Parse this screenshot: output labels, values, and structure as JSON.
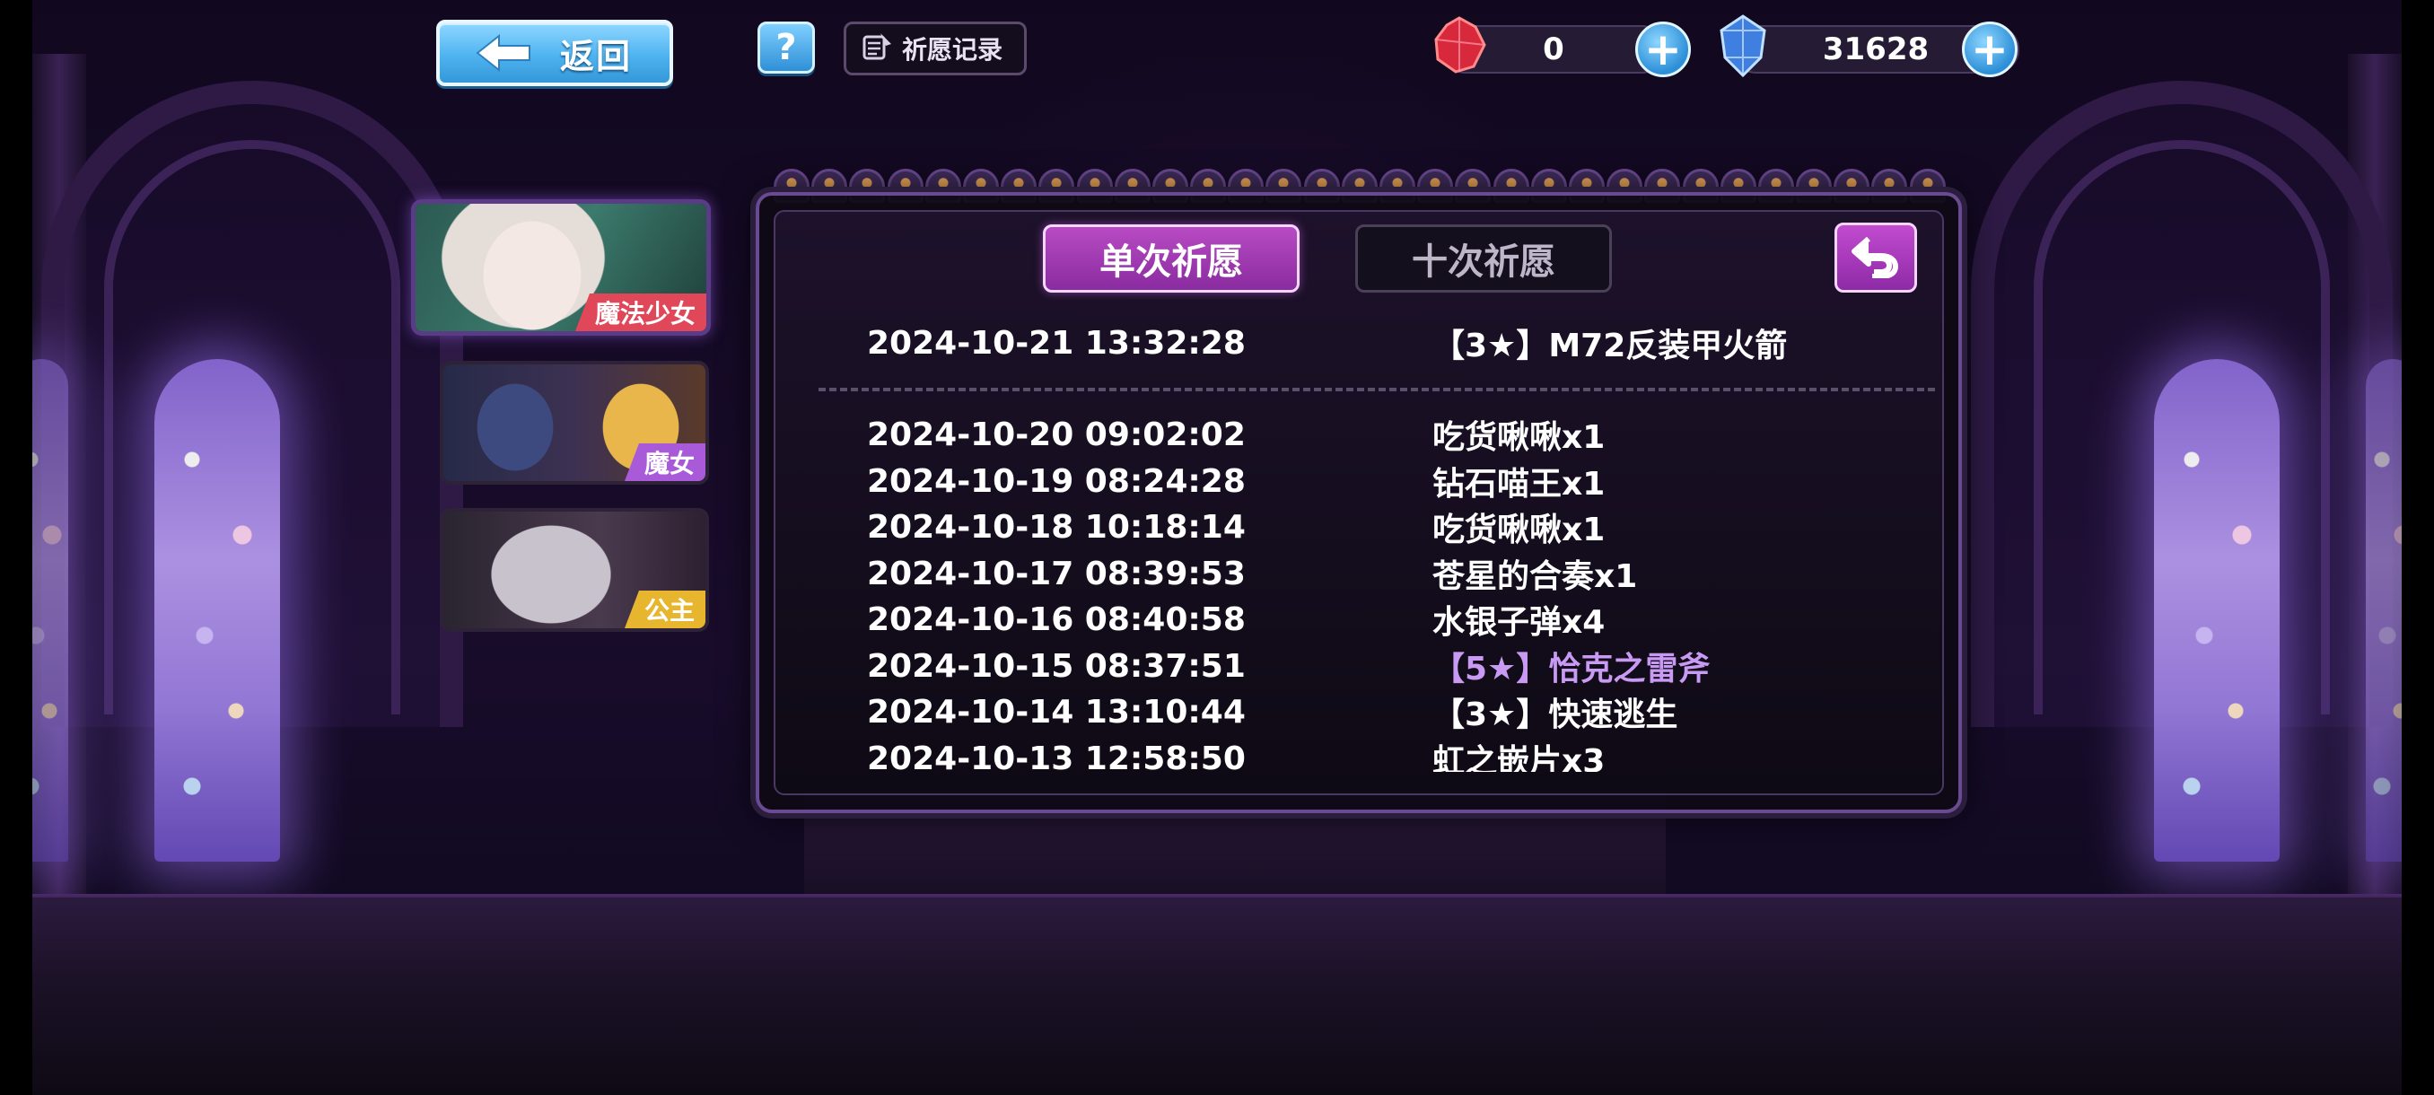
{
  "header": {
    "back_label": "返回",
    "help_label": "?",
    "record_label": "祈愿记录"
  },
  "currencies": [
    {
      "name": "red-gem",
      "value": "0"
    },
    {
      "name": "blue-crystal",
      "value": "31628"
    }
  ],
  "sidebar": {
    "tabs": [
      {
        "label": "魔法少女",
        "color": "#e0485a",
        "active": true
      },
      {
        "label": "魔女",
        "color": "#a85ad9",
        "active": false
      },
      {
        "label": "公主",
        "color": "#e8b62e",
        "active": false
      }
    ]
  },
  "panel": {
    "tab_single": "单次祈愿",
    "tab_ten": "十次祈愿",
    "featured": {
      "date": "2024-10-21 13:32:28",
      "item": "【3★】M72反装甲火箭"
    },
    "records": [
      {
        "date": "2024-10-20 09:02:02",
        "item": "吃货啾啾x1"
      },
      {
        "date": "2024-10-19 08:24:28",
        "item": "钻石喵王x1"
      },
      {
        "date": "2024-10-18 10:18:14",
        "item": "吃货啾啾x1"
      },
      {
        "date": "2024-10-17 08:39:53",
        "item": "苍星的合奏x1"
      },
      {
        "date": "2024-10-16 08:40:58",
        "item": "水银子弹x4"
      },
      {
        "date": "2024-10-15 08:37:51",
        "item": "【5★】恰克之雷斧",
        "highlight": true
      },
      {
        "date": "2024-10-14 13:10:44",
        "item": "【3★】快速逃生"
      },
      {
        "date": "2024-10-13 12:58:50",
        "item": "虹之嵌片x3"
      }
    ]
  },
  "colors": {
    "accent_purple": "#b84bc4",
    "highlight_text": "#c99af3",
    "button_blue": "#4fb3f0"
  }
}
